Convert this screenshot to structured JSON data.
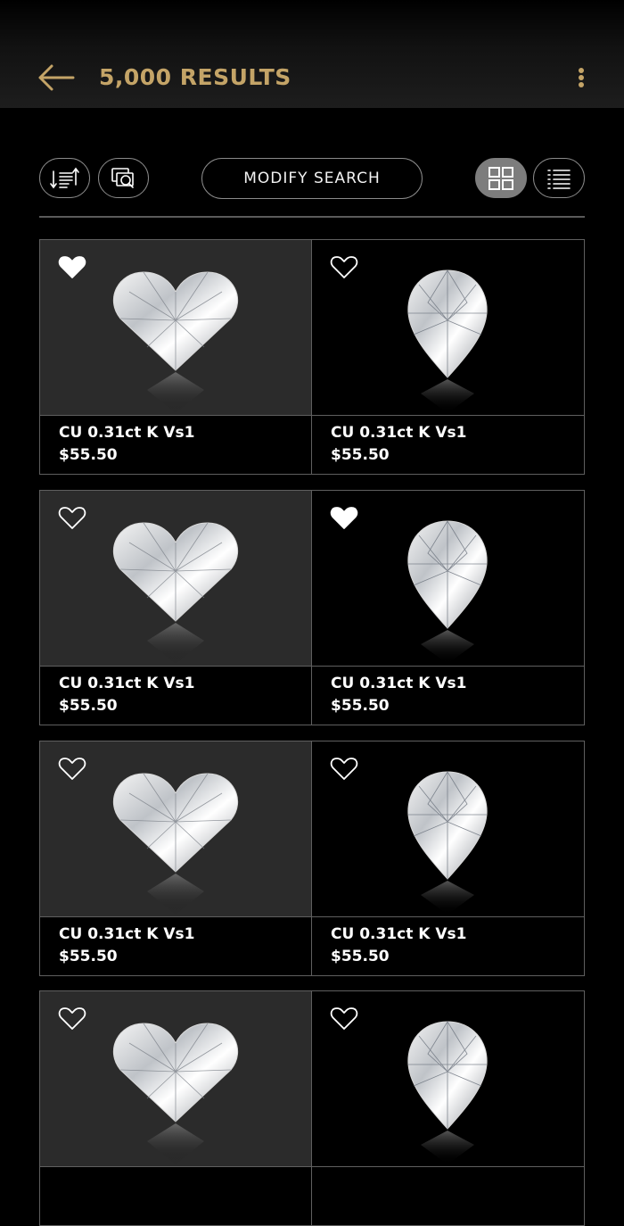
{
  "header": {
    "title": "5,000 RESULTS",
    "back_icon": "arrow-left-icon",
    "more_icon": "more-vertical-icon",
    "accent_color": "#c4a467"
  },
  "toolbar": {
    "sort_icon": "sort-icon",
    "compare_icon": "compare-search-icon",
    "modify_label": "MODIFY SEARCH",
    "grid_view_icon": "grid-view-icon",
    "list_view_icon": "list-view-icon",
    "active_view": "grid"
  },
  "results": [
    {
      "name": "CU 0.31ct K Vs1",
      "price": "$55.50",
      "shape": "heart",
      "favorited": true
    },
    {
      "name": "CU 0.31ct K Vs1",
      "price": "$55.50",
      "shape": "pear",
      "favorited": false
    },
    {
      "name": "CU 0.31ct K Vs1",
      "price": "$55.50",
      "shape": "heart",
      "favorited": false
    },
    {
      "name": "CU 0.31ct K Vs1",
      "price": "$55.50",
      "shape": "pear",
      "favorited": true
    },
    {
      "name": "CU 0.31ct K Vs1",
      "price": "$55.50",
      "shape": "heart",
      "favorited": false
    },
    {
      "name": "CU 0.31ct K Vs1",
      "price": "$55.50",
      "shape": "pear",
      "favorited": false
    },
    {
      "name": "",
      "price": "",
      "shape": "heart",
      "favorited": false
    },
    {
      "name": "",
      "price": "",
      "shape": "pear",
      "favorited": false
    }
  ]
}
